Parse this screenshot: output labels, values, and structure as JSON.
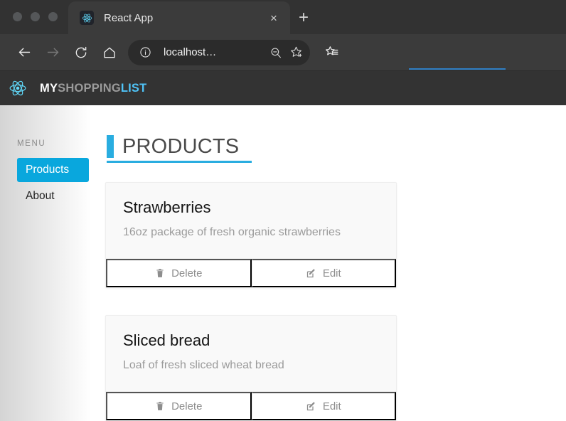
{
  "browser": {
    "window_controls": [
      "close",
      "minimize",
      "maximize"
    ],
    "tab": {
      "title": "React App",
      "favicon": "react-logo-icon",
      "close_label": "×"
    },
    "new_tab_label": "+",
    "toolbar": {
      "back": "back-arrow-icon",
      "forward": "forward-arrow-icon",
      "reload": "reload-icon",
      "home": "home-icon",
      "site_info": "info-circle-icon",
      "url": "localhost…",
      "zoom_out": "zoom-out-icon",
      "bookmark_add": "star-plus-icon",
      "reading_list": "star-list-icon"
    }
  },
  "app": {
    "logo": "react-logo-icon",
    "brand": {
      "part1": "MY",
      "part2": "SHOPPING",
      "part3": "LIST"
    },
    "sidebar": {
      "label": "MENU",
      "items": [
        {
          "label": "Products",
          "active": true
        },
        {
          "label": "About",
          "active": false
        }
      ]
    },
    "main": {
      "page_title": "PRODUCTS",
      "cards": [
        {
          "title": "Strawberries",
          "description": "16oz package of fresh organic strawberries",
          "actions": [
            {
              "label": "Delete",
              "icon": "trash-icon"
            },
            {
              "label": "Edit",
              "icon": "pen-to-square-icon"
            }
          ]
        },
        {
          "title": "Sliced bread",
          "description": "Loaf of fresh sliced wheat bread",
          "actions": [
            {
              "label": "Delete",
              "icon": "trash-icon"
            },
            {
              "label": "Edit",
              "icon": "pen-to-square-icon"
            }
          ]
        }
      ]
    }
  },
  "colors": {
    "accent": "#29ADE0",
    "accent_active": "#09A7DD",
    "brand_highlight": "#4FC3F7",
    "chrome_dark": "#3B3B3B",
    "navbar_dark": "#333333",
    "card_bg": "#F9F9F9",
    "muted_text": "#9B9B9B",
    "loading_bar": "#2F7FC4"
  }
}
